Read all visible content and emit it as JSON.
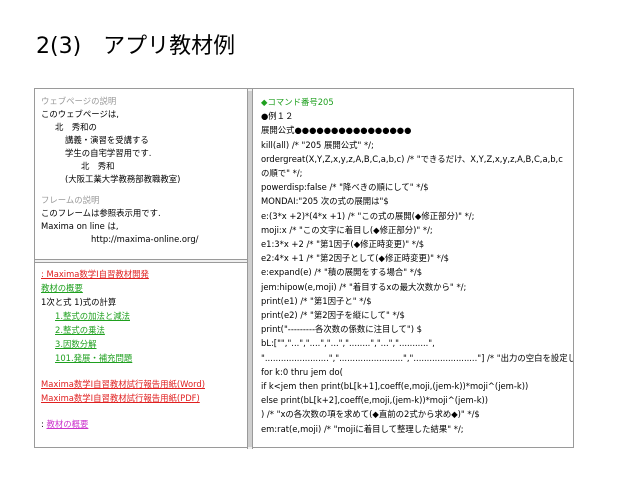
{
  "slide": {
    "title": "2(3)　アプリ教材例"
  },
  "top_left": {
    "section1_head": "ウェブページの説明",
    "section1_lines": [
      "このウェブページは,",
      "北　秀和の",
      "講義・演習を受講する",
      "学生の自宅学習用です.",
      "北　秀和",
      "(大阪工業大学教務部教職教室)"
    ],
    "section2_head": "フレームの説明",
    "section2_lines": [
      "このフレームは参照表示用です.",
      "Maxima on line は,",
      "http://maxima-online.org/"
    ]
  },
  "bottom_left": {
    "links_top": [
      ": Maxima数学Ⅰ自習教材開発",
      "教材の概要"
    ],
    "topic": "1次と式 1)式の計算",
    "sub_links": [
      "1.整式の加法と減法",
      "2.整式の乗法",
      "3.因数分解",
      "101.発展・補充問題"
    ],
    "doc_links": [
      "Maxima数学Ⅰ自習教材試行報告用紙(Word)",
      "Maxima数学Ⅰ自習教材試行報告用紙(PDF)"
    ],
    "overview_prefix": ": ",
    "overview_link": "教材の概要"
  },
  "right": {
    "command_head": "◆コマンド番号205",
    "lines": [
      "●例１２",
      "展開公式●●●●●●●●●●●●●●●●",
      "kill(all) /* \"205 展開公式\" */;",
      "ordergreat(X,Y,Z,x,y,z,A,B,C,a,b,c) /* \"できるだけ、X,Y,Z,x,y,z,A,B,C,a,b,c",
      "の順で\" */;",
      "powerdisp:false /* \"降べきの順にして\" */$",
      "MONDAI:\"205 次の式の展開は\"$",
      "e:(3*x +2)*(4*x +1) /* \"この式の展開(◆修正部分)\" */;",
      "moji:x /* \"この文字に着目し(◆修正部分)\" */;",
      "e1:3*x +2 /* \"第1因子(◆修正時変更)\" */$",
      "e2:4*x +1 /* \"第2因子として(◆修正時変更)\" */$",
      "e:expand(e) /* \"積の展開をする場合\" */$",
      "jem:hipow(e,moji) /* \"着目するxの最大次数から\" */;",
      "print(e1) /* \"第1因子と\" */$",
      "print(e2) /* \"第2因子を縦にして\" */$",
      "print(\"---------各次数の係数に注目して\") $",
      "bL:[\"\",\"...\",\"....\",\"...\",\"........\",\"...\",\"...........\",",
      "\"........................\",\"........................\",\"........................\"] /* \"出力の空白を設定し\" */$",
      "for k:0 thru jem do(",
      "if k<jem then print(bL[k+1],coeff(e,moji,(jem-k))*moji^(jem-k))",
      "else print(bL[k+2],coeff(e,moji,(jem-k))*moji^(jem-k))",
      ") /* \"xの各次数の項を求めて(◆直前の2式から求め◆)\" */$",
      "em:rat(e,moji) /* \"mojiに着目して整理した結果\" */;"
    ]
  }
}
